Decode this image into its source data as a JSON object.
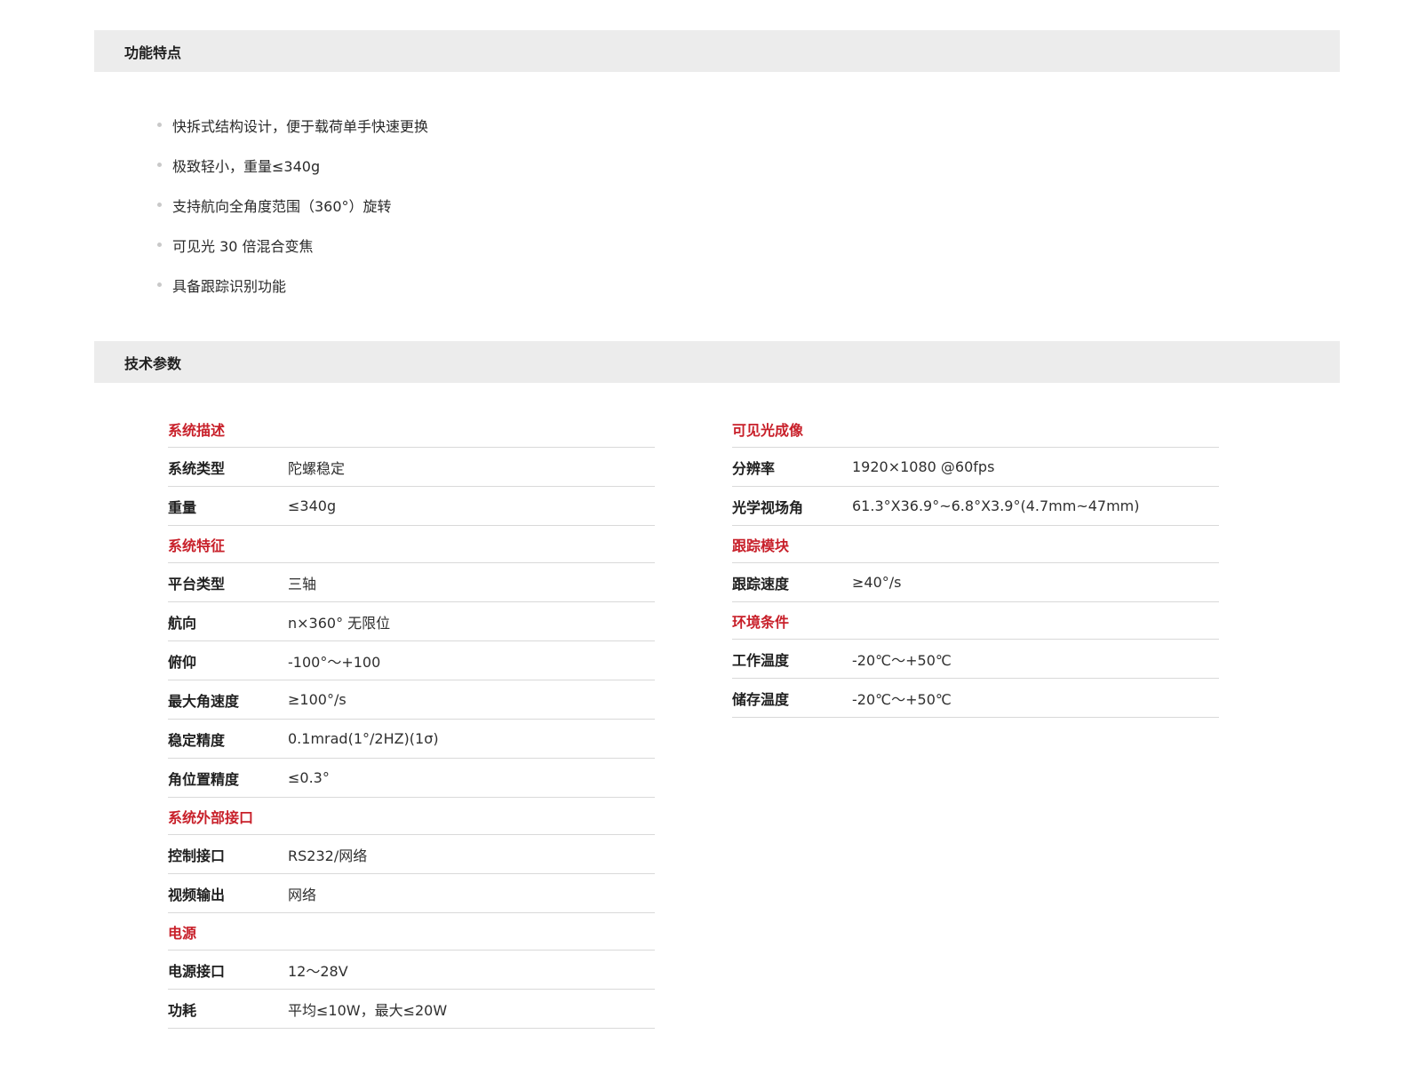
{
  "features": {
    "title": "功能特点",
    "items": [
      "快拆式结构设计，便于载荷单手快速更换",
      "极致轻小，重量≤340g",
      "支持航向全角度范围（360°）旋转",
      "可见光 30 倍混合变焦",
      "具备跟踪识别功能"
    ]
  },
  "specs": {
    "title": "技术参数",
    "left": [
      {
        "group": "系统描述",
        "rows": [
          {
            "label": "系统类型",
            "value": "陀螺稳定"
          },
          {
            "label": "重量",
            "value": "≤340g"
          }
        ]
      },
      {
        "group": "系统特征",
        "rows": [
          {
            "label": "平台类型",
            "value": "三轴"
          },
          {
            "label": "航向",
            "value": "n×360°  无限位"
          },
          {
            "label": "俯仰",
            "value": "-100°～+100"
          },
          {
            "label": "最大角速度",
            "value": "≥100°/s"
          },
          {
            "label": "稳定精度",
            "value": "0.1mrad(1°/2HZ)(1σ)"
          },
          {
            "label": "角位置精度",
            "value": "≤0.3°"
          }
        ]
      },
      {
        "group": "系统外部接口",
        "rows": [
          {
            "label": "控制接口",
            "value": "RS232/网络"
          },
          {
            "label": "视频输出",
            "value": "网络"
          }
        ]
      },
      {
        "group": "电源",
        "rows": [
          {
            "label": "电源接口",
            "value": "12～28V"
          },
          {
            "label": "功耗",
            "value": "平均≤10W，最大≤20W"
          }
        ]
      }
    ],
    "right": [
      {
        "group": "可见光成像",
        "rows": [
          {
            "label": "分辨率",
            "value": "1920×1080 @60fps"
          },
          {
            "label": "光学视场角",
            "value": "61.3°X36.9°~6.8°X3.9°(4.7mm~47mm)"
          }
        ]
      },
      {
        "group": "跟踪模块",
        "rows": [
          {
            "label": "跟踪速度",
            "value": "≥40°/s"
          }
        ]
      },
      {
        "group": "环境条件",
        "rows": [
          {
            "label": "工作温度",
            "value": "-20℃～+50℃"
          },
          {
            "label": "储存温度",
            "value": "-20℃～+50℃"
          }
        ]
      }
    ]
  }
}
